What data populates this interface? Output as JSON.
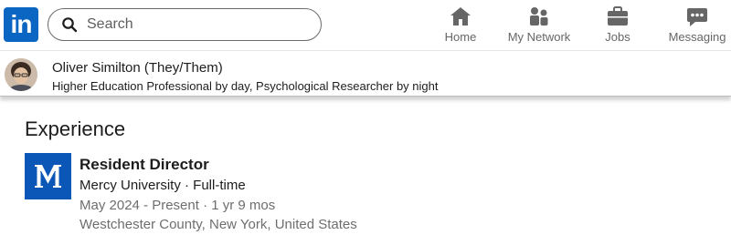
{
  "nav": {
    "logo_text": "in",
    "search": {
      "placeholder": "Search"
    },
    "items": [
      {
        "label": "Home",
        "icon": "home-icon"
      },
      {
        "label": "My Network",
        "icon": "network-icon"
      },
      {
        "label": "Jobs",
        "icon": "briefcase-icon"
      },
      {
        "label": "Messaging",
        "icon": "messaging-icon"
      }
    ],
    "brand_color": "#0a66c2",
    "icon_color": "#666666"
  },
  "profile_bar": {
    "name": "Oliver Similton",
    "pronouns": "(They/Them)",
    "headline": "Higher Education Professional by day, Psychological Researcher by night"
  },
  "experience": {
    "section_title": "Experience",
    "entries": [
      {
        "title": "Resident Director",
        "company_line": "Mercy University · Full-time",
        "dates": "May 2024 - Present · 1 yr 9 mos",
        "location": "Westchester County, New York, United States",
        "logo_color": "#0b57b7"
      }
    ]
  }
}
